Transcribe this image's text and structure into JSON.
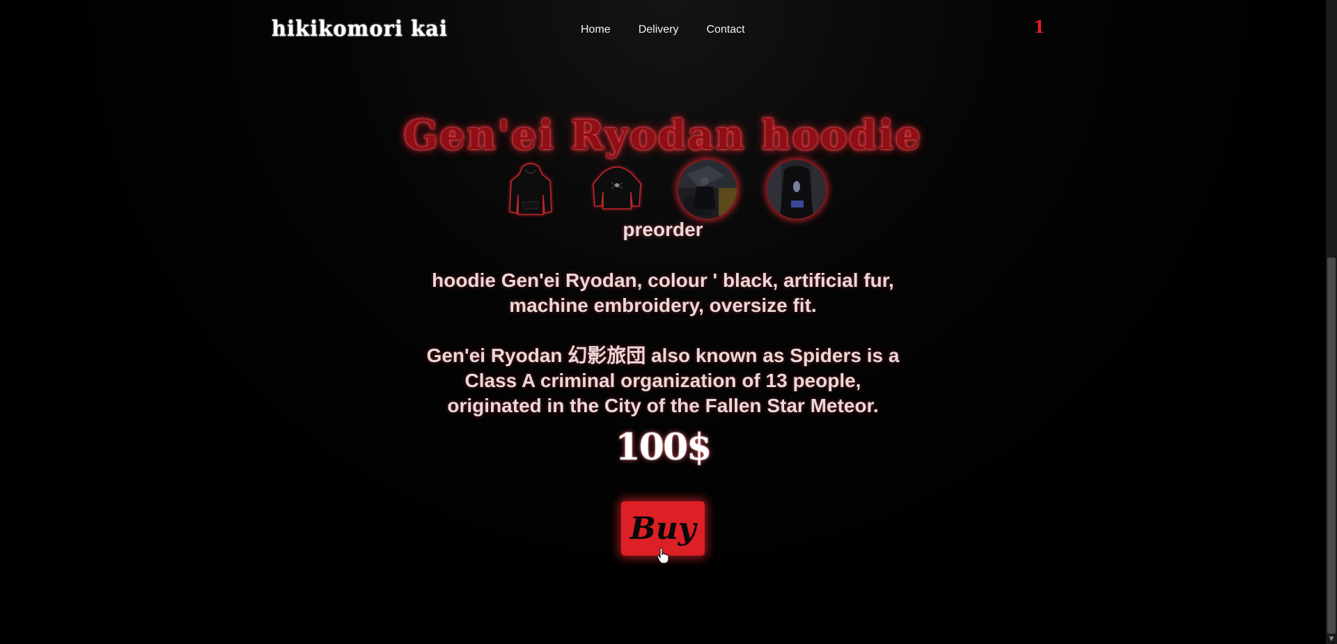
{
  "header": {
    "logo": "hikikomori kai",
    "nav": [
      {
        "label": "Home"
      },
      {
        "label": "Delivery"
      },
      {
        "label": "Contact"
      }
    ],
    "cart_count": "1"
  },
  "product": {
    "title": "Gen'ei Ryodan hoodie",
    "thumbnails": [
      {
        "icon": "hoodie-front-icon"
      },
      {
        "icon": "hoodie-back-icon"
      },
      {
        "icon": "model-photo-1"
      },
      {
        "icon": "model-photo-2"
      }
    ],
    "status": "preorder",
    "description_1": "hoodie Gen'ei Ryodan, colour ' black, artificial fur, machine embroidery, oversize fit.",
    "description_2": "Gen'ei Ryodan 幻影旅団 also known as Spiders is a Class A criminal organization of 13 people, originated in the City of the Fallen Star Meteor.",
    "price": "100$",
    "buy_label": "Buy"
  },
  "colors": {
    "accent": "#dd1f26",
    "background": "#000000",
    "text": "#e6dada"
  }
}
